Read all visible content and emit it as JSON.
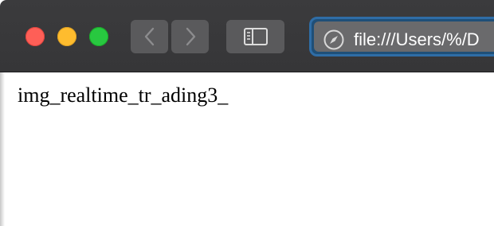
{
  "window": {
    "traffic_lights": {
      "close_color": "#fe5f57",
      "minimize_color": "#febc2e",
      "zoom_color": "#28c840"
    }
  },
  "toolbar": {
    "back_icon": "chevron-left-icon",
    "forward_icon": "chevron-right-icon",
    "sidebar_icon": "sidebar-icon",
    "address_icon": "compass-icon",
    "address_value": "file:///Users/%/D",
    "accent_color": "#2f6da6"
  },
  "page": {
    "text": "img_realtime_tr_ading3_"
  }
}
